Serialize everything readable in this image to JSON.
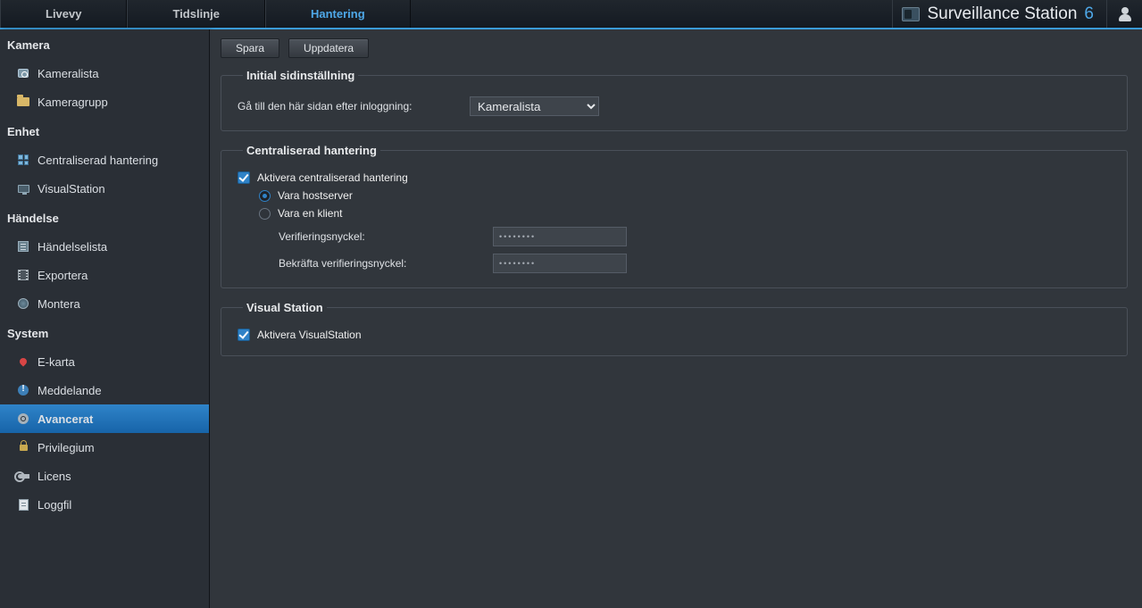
{
  "top": {
    "tabs": [
      {
        "id": "live",
        "label": "Livevy"
      },
      {
        "id": "timeline",
        "label": "Tidslinje"
      },
      {
        "id": "manage",
        "label": "Hantering"
      }
    ],
    "active_tab": "manage",
    "brand_text": "Surveillance Station",
    "brand_version": "6"
  },
  "sidebar": {
    "groups": [
      {
        "title": "Kamera",
        "items": [
          {
            "id": "camlist",
            "label": "Kameralista",
            "icon": "camera"
          },
          {
            "id": "camgroup",
            "label": "Kameragrupp",
            "icon": "folder"
          }
        ]
      },
      {
        "title": "Enhet",
        "items": [
          {
            "id": "central",
            "label": "Centraliserad hantering",
            "icon": "grid"
          },
          {
            "id": "visualstation",
            "label": "VisualStation",
            "icon": "monitor"
          }
        ]
      },
      {
        "title": "Händelse",
        "items": [
          {
            "id": "eventlist",
            "label": "Händelselista",
            "icon": "list"
          },
          {
            "id": "export",
            "label": "Exportera",
            "icon": "film"
          },
          {
            "id": "mount",
            "label": "Montera",
            "icon": "globe"
          }
        ]
      },
      {
        "title": "System",
        "items": [
          {
            "id": "emap",
            "label": "E-karta",
            "icon": "pin"
          },
          {
            "id": "notification",
            "label": "Meddelande",
            "icon": "alert"
          },
          {
            "id": "advanced",
            "label": "Avancerat",
            "icon": "gear"
          },
          {
            "id": "privilege",
            "label": "Privilegium",
            "icon": "lock"
          },
          {
            "id": "license",
            "label": "Licens",
            "icon": "key"
          },
          {
            "id": "log",
            "label": "Loggfil",
            "icon": "log"
          }
        ]
      }
    ],
    "active_item": "advanced"
  },
  "toolbar": {
    "save_label": "Spara",
    "refresh_label": "Uppdatera"
  },
  "sections": {
    "initial": {
      "legend": "Initial sidinställning",
      "goto_label": "Gå till den här sidan efter inloggning:",
      "goto_value": "Kameralista"
    },
    "cms": {
      "legend": "Centraliserad hantering",
      "enable_label": "Aktivera centraliserad hantering",
      "enable_checked": true,
      "role_host_label": "Vara hostserver",
      "role_client_label": "Vara en klient",
      "role_value": "host",
      "verify_label": "Verifieringsnyckel:",
      "confirm_label": "Bekräfta verifieringsnyckel:",
      "pw_value": "••••••••",
      "pw_confirm_value": "••••••••"
    },
    "vs": {
      "legend": "Visual Station",
      "enable_label": "Aktivera VisualStation",
      "enable_checked": true
    }
  }
}
